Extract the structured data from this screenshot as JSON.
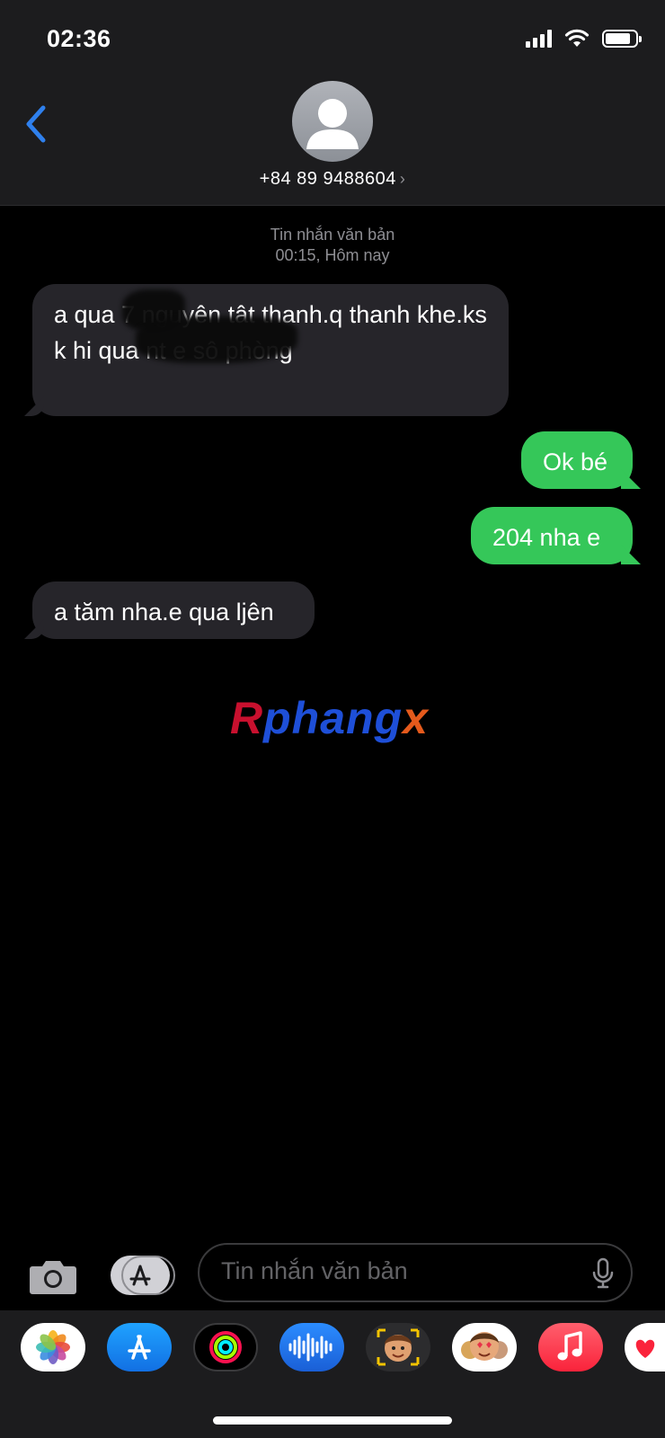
{
  "status": {
    "time": "02:36"
  },
  "header": {
    "contact": "+84 89 9488604",
    "chevron": "›"
  },
  "thread": {
    "service": "Tin nhắn văn bản",
    "timestamp": "00:15, Hôm nay"
  },
  "messages": [
    {
      "direction": "received",
      "text": "a qua 7  nguyên tât thanh.q thanh khe.ks k  hi  qua nt e sô phòng"
    },
    {
      "direction": "sent",
      "text": "Ok bé"
    },
    {
      "direction": "sent",
      "text": "204 nha e"
    },
    {
      "direction": "received",
      "text": "a tăm nha.e qua ljên"
    }
  ],
  "watermark": {
    "part1": "R",
    "part2": "phang",
    "part3": "x"
  },
  "composer": {
    "placeholder": "Tin nhắn văn bản"
  },
  "app_drawer": {
    "apps": [
      "photos-app",
      "app-store-app",
      "activity-app",
      "audio-message-app",
      "memoji-app",
      "memoji-stickers-app",
      "music-app",
      "more-app"
    ]
  },
  "colors": {
    "sent_bubble": "#35c759",
    "received_bubble": "#26252a",
    "accent": "#2f80ed"
  }
}
